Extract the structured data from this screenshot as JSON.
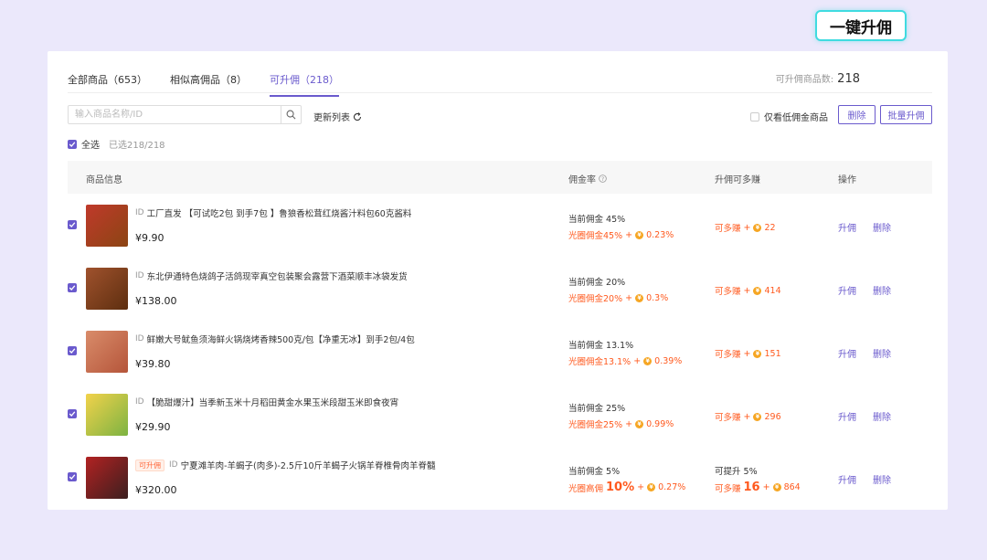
{
  "tabs": [
    {
      "label": "全部商品（653）"
    },
    {
      "label": "相似高佣品（8）"
    },
    {
      "label": "可升佣（218）"
    }
  ],
  "summary": {
    "count_label": "可升佣商品数:",
    "count_value": "218"
  },
  "one_key_button": "一键升佣",
  "search": {
    "placeholder": "输入商品名称/ID"
  },
  "refresh_label": "更新列表",
  "low_filter_label": "仅看低佣金商品",
  "delete_button": "删除",
  "batch_button": "批量升佣",
  "select_all": {
    "label": "全选",
    "info": "已选218/218"
  },
  "columns": {
    "product": "商品信息",
    "rate": "佣金率",
    "earn": "升佣可多赚",
    "ops": "操作"
  },
  "rows": [
    {
      "id_label": "ID",
      "title": "工厂直发 【可试吃2包 到手7包 】鲁狼香松茸红烧酱汁料包60克酱料",
      "price": "¥9.90",
      "current_rate": "当前佣金 45%",
      "boost_label": "光圈佣金45%",
      "boost_extra": "0.23%",
      "earn_label": "可多赚",
      "earn_value": "22",
      "op_upgrade": "升佣",
      "op_delete": "删除",
      "colors": [
        "#c0392b",
        "#8b4513"
      ]
    },
    {
      "id_label": "ID",
      "title": "东北伊通特色烧鸽子活鸽现宰真空包装聚会露营下酒菜顺丰冰袋发货",
      "price": "¥138.00",
      "current_rate": "当前佣金 20%",
      "boost_label": "光圈佣金20%",
      "boost_extra": "0.3%",
      "earn_label": "可多赚",
      "earn_value": "414",
      "op_upgrade": "升佣",
      "op_delete": "删除",
      "colors": [
        "#a0522d",
        "#5d2e0f"
      ]
    },
    {
      "id_label": "ID",
      "title": "鲜嫩大号鱿鱼须海鲜火锅烧烤香辣500克/包【净重无冰】到手2包/4包",
      "price": "¥39.80",
      "current_rate": "当前佣金 13.1%",
      "boost_label": "光圈佣金13.1%",
      "boost_extra": "0.39%",
      "earn_label": "可多赚",
      "earn_value": "151",
      "op_upgrade": "升佣",
      "op_delete": "删除",
      "colors": [
        "#d98c6a",
        "#b5553a"
      ]
    },
    {
      "id_label": "ID",
      "title": "【脆甜爆汁】当季新玉米十月稻田黄金水果玉米段甜玉米即食夜宵",
      "price": "¥29.90",
      "current_rate": "当前佣金 25%",
      "boost_label": "光圈佣金25%",
      "boost_extra": "0.99%",
      "earn_label": "可多赚",
      "earn_value": "296",
      "op_upgrade": "升佣",
      "op_delete": "删除",
      "colors": [
        "#f2d24b",
        "#7cb342"
      ]
    },
    {
      "badge": "可升佣",
      "id_label": "ID",
      "title": "宁夏滩羊肉-羊蝎子(肉多)-2.5斤10斤羊蝎子火锅羊脊椎骨肉羊脊髓",
      "price": "¥320.00",
      "current_rate": "当前佣金 5%",
      "boost_label": "光圈高佣",
      "boost_big": "10%",
      "boost_extra": "0.27%",
      "earn_top": "可提升 5%",
      "earn_label": "可多赚",
      "earn_big": "16",
      "earn_value": "864",
      "op_upgrade": "升佣",
      "op_delete": "删除",
      "colors": [
        "#b22222",
        "#3b1f1f"
      ]
    }
  ],
  "accent_color": "#6a5acd",
  "highlight_color": "#3fdbe0",
  "orange_color": "#ff5a1f"
}
